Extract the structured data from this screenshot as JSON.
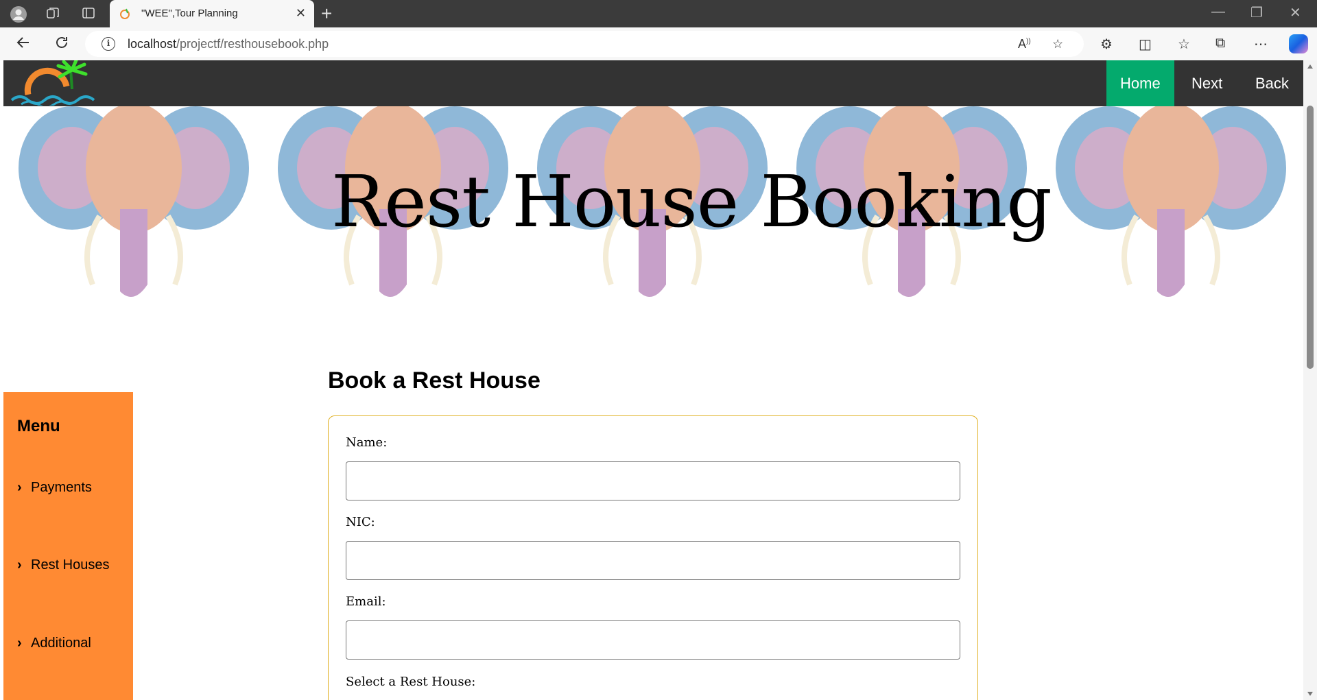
{
  "browser": {
    "tab_title": "\"WEE\",Tour Planning",
    "tab_close": "✕",
    "new_tab": "+",
    "url_host": "localhost",
    "url_path": "/projectf/resthousebook.php",
    "window_controls": {
      "minimize": "—",
      "restore": "❐",
      "close": "✕"
    }
  },
  "site_nav": {
    "items": [
      {
        "label": "Home",
        "active": true
      },
      {
        "label": "Next",
        "active": false
      },
      {
        "label": "Back",
        "active": false
      }
    ]
  },
  "banner": {
    "title": "Rest House Booking"
  },
  "sidebar": {
    "heading": "Menu",
    "items": [
      {
        "label": "Payments"
      },
      {
        "label": "Rest Houses"
      },
      {
        "label": "Additional"
      }
    ]
  },
  "form": {
    "title": "Book a Rest House",
    "fields": [
      {
        "label": "Name:",
        "value": ""
      },
      {
        "label": "NIC:",
        "value": ""
      },
      {
        "label": "Email:",
        "value": ""
      },
      {
        "label": "Select a Rest House:"
      }
    ]
  },
  "colors": {
    "nav_bg": "#333333",
    "nav_active": "#04aa6d",
    "sidebar_bg": "#ff8a33",
    "form_border": "#e0b022"
  }
}
